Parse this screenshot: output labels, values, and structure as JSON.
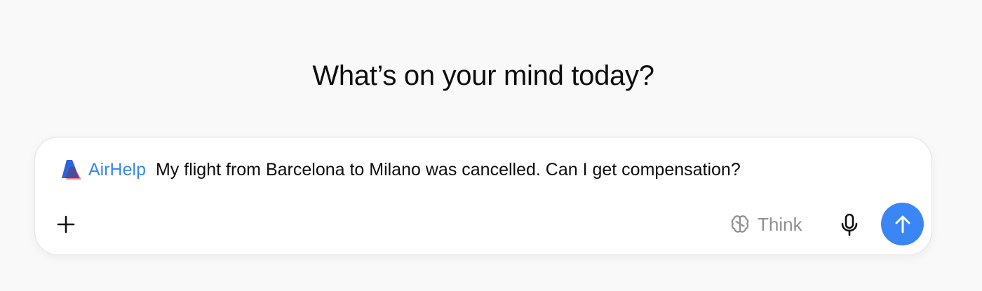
{
  "headline": "What’s on your mind today?",
  "composer": {
    "app": {
      "name": "AirHelp",
      "icon": "airhelp-logo-icon",
      "color": "#3a86f3"
    },
    "prompt_text": "My flight from Barcelona to Milano was cancelled. Can I get compensation?",
    "toolbar": {
      "add_icon": "plus-icon",
      "think_label": "Think",
      "think_icon": "brain-icon",
      "mic_icon": "microphone-icon",
      "send_icon": "arrow-up-icon",
      "send_color": "#3b86f5"
    }
  }
}
